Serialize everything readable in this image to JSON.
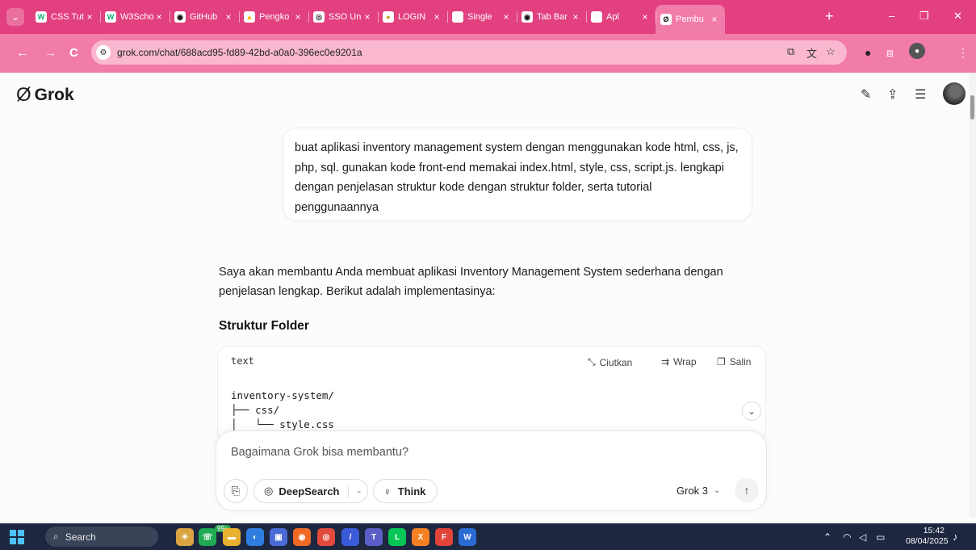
{
  "browser": {
    "menu_glyph": "⌄",
    "tabs": [
      {
        "title": "CSS Tut",
        "favicon": "W",
        "favicon_color": "#04aa6d"
      },
      {
        "title": "W3Scho",
        "favicon": "W",
        "favicon_color": "#04aa6d"
      },
      {
        "title": "GitHub",
        "favicon": "◉",
        "favicon_color": "#111111"
      },
      {
        "title": "Pengko",
        "favicon": "▲",
        "favicon_color": "#f5b400"
      },
      {
        "title": "SSO Un",
        "favicon": "◎",
        "favicon_color": "#333333"
      },
      {
        "title": "LOGIN",
        "favicon": "●",
        "favicon_color": "#c9a227"
      },
      {
        "title": "Single",
        "favicon": "◌",
        "favicon_color": "#b0b0b0"
      },
      {
        "title": "Tab Bar",
        "favicon": "◉",
        "favicon_color": "#111111"
      },
      {
        "title": "Apl",
        "favicon": "◌",
        "favicon_color": "#b0b0b0"
      },
      {
        "title": "Pembu",
        "favicon": "Ø",
        "favicon_color": "#111111"
      }
    ],
    "close_glyph": "×",
    "new_tab": "+",
    "window_controls": {
      "minimize": "–",
      "restore": "❐",
      "close": "✕"
    },
    "url": "grok.com/chat/688acd95-fd89-42bd-a0a0-396ec0e9201a",
    "nav": {
      "back": "←",
      "forward": "→",
      "reload": "C"
    }
  },
  "grok": {
    "logo_text": "Grok",
    "logo_mark": "Ø",
    "header_icons": {
      "edit": "✎",
      "share": "⇪",
      "history": "☰"
    },
    "user_message": "buat aplikasi inventory management system dengan menggunakan kode html, css, js, php, sql. gunakan kode front-end memakai  index.html, style, css, script.js. lengkapi dengan  penjelasan struktur kode dengan struktur folder, serta tutorial penggunaannya",
    "answer_intro": "Saya akan membantu Anda membuat aplikasi Inventory Management System sederhana dengan penjelasan lengkap. Berikut adalah implementasinya:",
    "section_title": "Struktur Folder",
    "code": {
      "lang": "text",
      "actions": {
        "collapse": "Ciutkan",
        "wrap": "Wrap",
        "copy": "Salin"
      },
      "lines": [
        "inventory-system/",
        "├── css/",
        "│   └── style.css"
      ]
    },
    "composer": {
      "placeholder": "Bagaimana Grok bisa membantu?",
      "deepsearch": "DeepSearch",
      "think": "Think",
      "model": "Grok 3"
    }
  },
  "taskbar": {
    "search": "Search",
    "badge": "99+",
    "time": "15:42",
    "date": "08/04/2025"
  }
}
